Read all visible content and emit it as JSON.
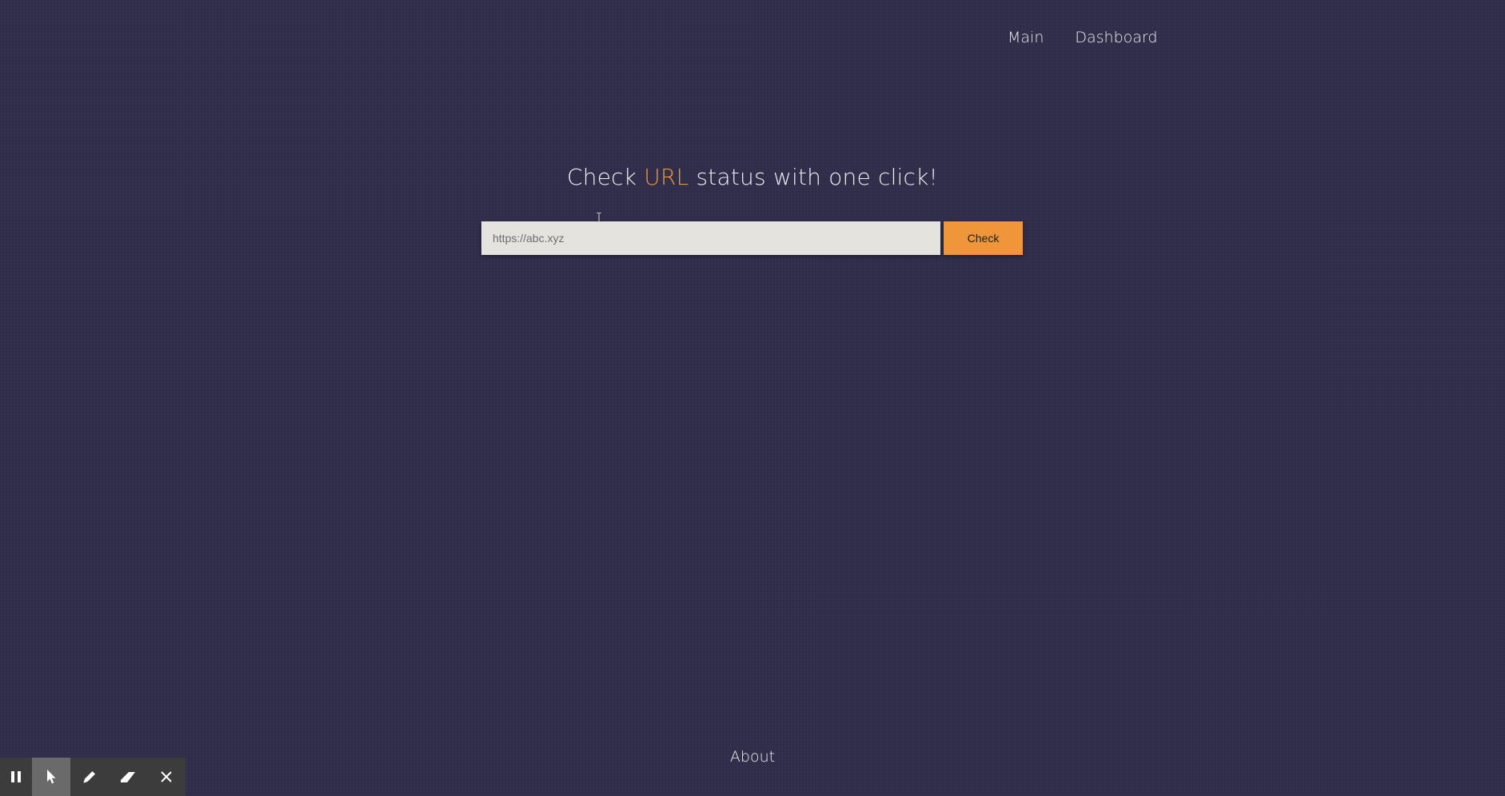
{
  "nav": {
    "main_label": "Main",
    "dashboard_label": "Dashboard"
  },
  "hero": {
    "title_before": "Check ",
    "title_accent": "URL",
    "title_after": " status with one click!"
  },
  "search": {
    "placeholder": "https://abc.xyz",
    "value": "",
    "button_label": "Check"
  },
  "footer": {
    "about_label": "About"
  },
  "toolbar": {
    "tools": [
      "pause-icon",
      "pointer-icon",
      "pencil-icon",
      "eraser-icon",
      "close-icon"
    ],
    "active_tool": "pointer-icon"
  },
  "colors": {
    "background": "#2f2d4a",
    "accent": "#f0963a",
    "input_background": "#e4e3de",
    "text": "#ededf2"
  }
}
